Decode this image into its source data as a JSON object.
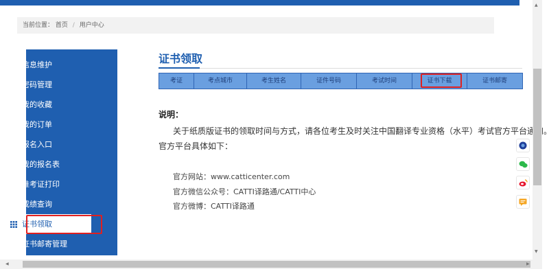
{
  "breadcrumb": {
    "prefix": "当前位置：",
    "home": "首页",
    "separator": "/",
    "current": "用户中心"
  },
  "sidebar": {
    "items": [
      {
        "label": "信息维护",
        "icon": "user-icon"
      },
      {
        "label": "密码管理",
        "icon": "lock-icon"
      },
      {
        "label": "我的收藏",
        "icon": "star-icon"
      },
      {
        "label": "我的订单",
        "icon": "star-icon"
      },
      {
        "label": "报名入口",
        "icon": "list-icon"
      },
      {
        "label": "我的报名表",
        "icon": "list-icon"
      },
      {
        "label": "准考证打印",
        "icon": "grid-icon"
      },
      {
        "label": "成绩查询",
        "icon": "grid-icon"
      },
      {
        "label": "证书领取",
        "icon": "grid-icon",
        "active": true
      },
      {
        "label": "证书邮寄管理",
        "icon": "grid-icon"
      }
    ]
  },
  "main": {
    "title": "证书领取",
    "tabs": [
      "考证",
      "考点城市",
      "考生姓名",
      "证件号码",
      "考试时间",
      "证书下载",
      "证书邮寄"
    ],
    "note": {
      "title": "说明：",
      "line1": "关于纸质版证书的领取时间与方式，请各位考生及时关注中国翻译专业资格（水平）考试官方平台通知。",
      "line2": "官方平台具体如下："
    },
    "info": {
      "website": "官方网站：www.catticenter.com",
      "wechat": "官方微信公众号：CATTI译路通/CATTI中心",
      "weibo": "官方微博：CATTI译路通"
    }
  },
  "float_icons": [
    "service-icon",
    "wechat-icon",
    "weibo-icon",
    "message-icon"
  ],
  "colors": {
    "primary": "#1f5fb0",
    "tab_bg": "#6a9fe0",
    "highlight": "#e02020"
  }
}
